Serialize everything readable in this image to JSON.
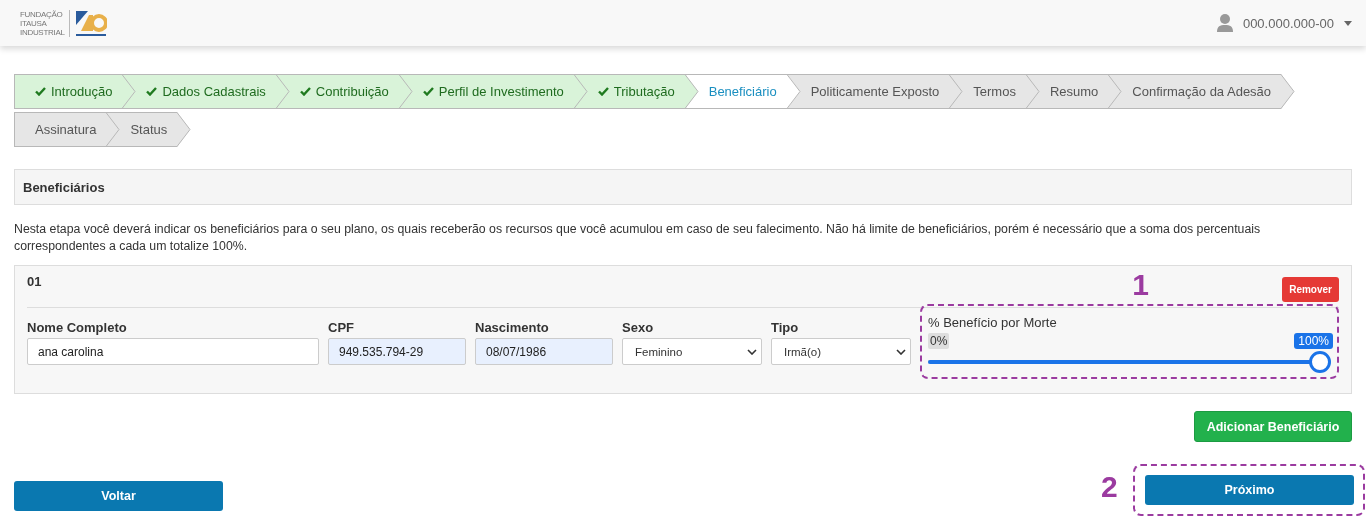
{
  "header": {
    "logo_lines": [
      "FUNDAÇÃO",
      "ITAUSA",
      "INDUSTRIAL"
    ],
    "user": "000.000.000-00"
  },
  "steps": [
    {
      "label": "Introdução",
      "done": true,
      "selected": false
    },
    {
      "label": "Dados Cadastrais",
      "done": true,
      "selected": false
    },
    {
      "label": "Contribuição",
      "done": true,
      "selected": false
    },
    {
      "label": "Perfil de Investimento",
      "done": true,
      "selected": false
    },
    {
      "label": "Tributação",
      "done": true,
      "selected": false
    },
    {
      "label": "Beneficiário",
      "done": false,
      "selected": true
    },
    {
      "label": "Politicamente Exposto",
      "done": false,
      "selected": false
    },
    {
      "label": "Termos",
      "done": false,
      "selected": false
    },
    {
      "label": "Resumo",
      "done": false,
      "selected": false
    },
    {
      "label": "Confirmação da Adesão",
      "done": false,
      "selected": false
    },
    {
      "label": "Assinatura",
      "done": false,
      "selected": false
    },
    {
      "label": "Status",
      "done": false,
      "selected": false
    }
  ],
  "section_title": "Beneficiários",
  "intro": "Nesta etapa você deverá indicar os beneficiários para o seu plano, os quais receberão os recursos que você acumulou em caso de seu falecimento. Não há limite de beneficiários, porém é necessário que a soma dos percentuais correspondentes a cada um totalize 100%.",
  "beneficiaries": [
    {
      "number": "01",
      "remove_label": "Remover",
      "fields": [
        {
          "kind": "text",
          "label": "Nome Completo",
          "value": "ana carolina",
          "prefilled": false
        },
        {
          "kind": "text",
          "label": "CPF",
          "value": "949.535.794-29",
          "prefilled": true
        },
        {
          "kind": "text",
          "label": "Nascimento",
          "value": "08/07/1986",
          "prefilled": true
        },
        {
          "kind": "select",
          "label": "Sexo",
          "value": "Feminino"
        },
        {
          "kind": "select",
          "label": "Tipo",
          "value": "Irmã(o)"
        }
      ],
      "slider": {
        "label": "% Benefício por Morte",
        "min_label": "0%",
        "value_label": "100%",
        "level": 1,
        "annotation": "1"
      }
    }
  ],
  "add_button": "Adicionar Beneficiário",
  "back_button": "Voltar",
  "next_button": {
    "label": "Próximo",
    "annotation": "2"
  }
}
